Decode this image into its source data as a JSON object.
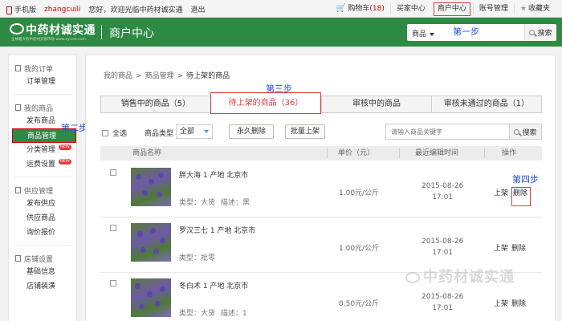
{
  "topbar": {
    "mobile_label": "手机版",
    "username": "zhangcuili",
    "greeting": "您好，欢迎光临中药材诚实通",
    "logout": "退出",
    "cart_label": "购物车",
    "cart_count": "(18)",
    "buyer_center": "买家中心",
    "merchant_center": "商户中心",
    "account_mgmt": "账号管理",
    "favorites": "收藏夹"
  },
  "header": {
    "logo_text": "中药材诚实通",
    "logo_sub": "全球最大的中药材交易市场 www.zyccst.com",
    "center_title": "商户中心",
    "search_category": "商品",
    "step1": "第一步",
    "search_button": "搜索"
  },
  "sidebar": {
    "sections": [
      {
        "title": "我的订单",
        "items": [
          "订单管理"
        ]
      },
      {
        "title": "我的商品",
        "items": [
          "发布商品",
          "商品管理",
          "分类管理",
          "运费设置"
        ]
      },
      {
        "title": "供应管理",
        "items": [
          "发布供应",
          "供应商品",
          "询价报价"
        ]
      },
      {
        "title": "店铺设置",
        "items": [
          "基础信息",
          "店铺装潢"
        ]
      }
    ],
    "new_badge": "NEW",
    "step2": "第二步"
  },
  "main": {
    "breadcrumb": [
      "我的商品",
      "商品管理",
      "待上架的商品"
    ],
    "step3": "第三步",
    "tabs": [
      "销售中的商品（5）",
      "待上架的商品（36）",
      "审核中的商品",
      "审核未通过的商品（1）"
    ],
    "toolbar": {
      "select_all": "全选",
      "type_label": "商品类型",
      "type_value": "全部",
      "perm_delete": "永久删除",
      "batch_list": "批量上架",
      "search_placeholder": "请输入商品关键字",
      "search_button": "搜索"
    },
    "columns": [
      "商品名称",
      "单价（元）",
      "最近编辑时间",
      "操作"
    ],
    "rows": [
      {
        "name": "胖大海 1 产地 北京市",
        "attr": "类型：大货",
        "desc": "描述：黑",
        "price": "1.00元/公斤",
        "date": "2015-08-26",
        "time": "17:01",
        "op_list": "上架",
        "op_delete": "删除"
      },
      {
        "name": "罗汉三七 1 产地 北京市",
        "attr": "类型：批零",
        "desc": "",
        "price": "1.00元/公斤",
        "date": "2015-08-26",
        "time": "17:01",
        "op_list": "上架",
        "op_delete": "删除"
      },
      {
        "name": "冬白术 1 产地 北京市",
        "attr": "类型：大货",
        "desc": "描述：1",
        "price": "0.50元/公斤",
        "date": "2015-08-26",
        "time": "17:01",
        "op_list": "上架",
        "op_delete": "删除"
      }
    ],
    "step4": "第四步"
  },
  "watermark": "中药材诚实通",
  "colors": {
    "brand_green": "#2d8a43",
    "accent_red": "#e4393c",
    "step_blue": "#2a4fd6"
  }
}
